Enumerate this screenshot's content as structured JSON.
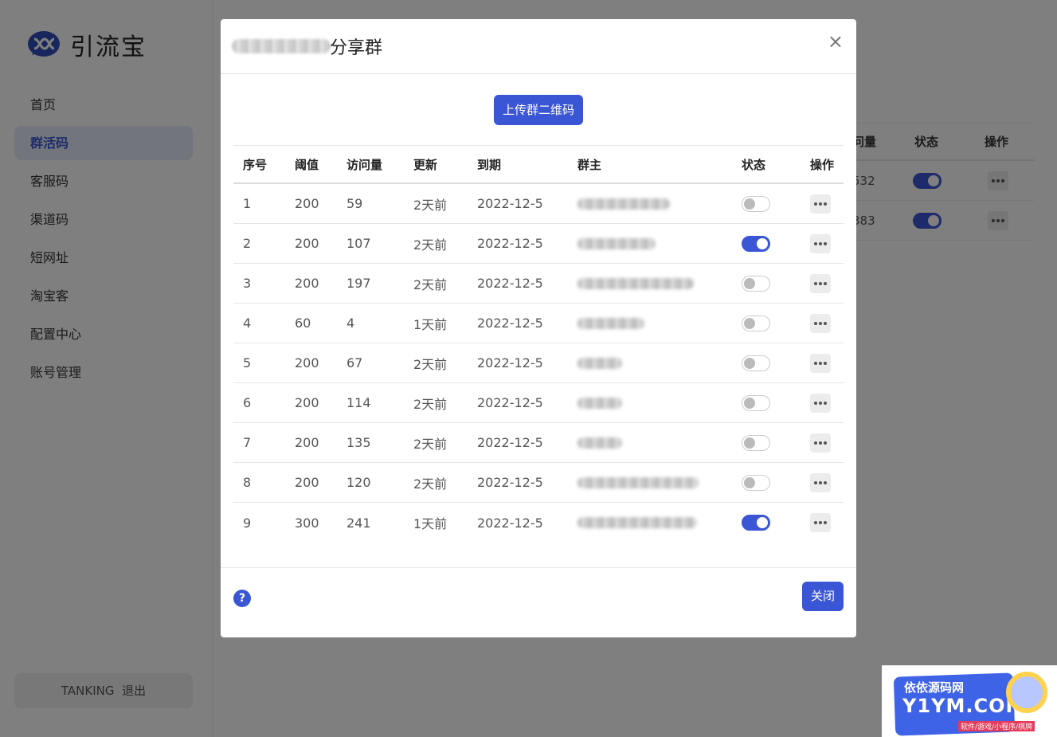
{
  "app": {
    "name": "引流宝",
    "nav": [
      "首页",
      "群活码",
      "客服码",
      "渠道码",
      "短网址",
      "淘宝客",
      "配置中心",
      "账号管理"
    ],
    "active_nav": "群活码",
    "user": {
      "name": "TANKING",
      "logout": "退出"
    }
  },
  "background_table": {
    "headers": {
      "visits": "问量",
      "status": "状态",
      "actions": "操作"
    },
    "rows": [
      {
        "visits": "532",
        "status": true
      },
      {
        "visits": "383",
        "status": true
      }
    ]
  },
  "modal": {
    "title_suffix": "分享群",
    "close_symbol": "×",
    "upload_button": "上传群二维码",
    "columns": {
      "index": "序号",
      "threshold": "阈值",
      "visits": "访问量",
      "updated": "更新",
      "expires": "到期",
      "owner": "群主",
      "status": "状态",
      "actions": "操作"
    },
    "rows": [
      {
        "index": "1",
        "threshold": "200",
        "visits": "59",
        "updated": "2天前",
        "expires": "2022-12-5",
        "status": false
      },
      {
        "index": "2",
        "threshold": "200",
        "visits": "107",
        "updated": "2天前",
        "expires": "2022-12-5",
        "status": true
      },
      {
        "index": "3",
        "threshold": "200",
        "visits": "197",
        "updated": "2天前",
        "expires": "2022-12-5",
        "status": false
      },
      {
        "index": "4",
        "threshold": "60",
        "visits": "4",
        "updated": "1天前",
        "expires": "2022-12-5",
        "status": false
      },
      {
        "index": "5",
        "threshold": "200",
        "visits": "67",
        "updated": "2天前",
        "expires": "2022-12-5",
        "status": false
      },
      {
        "index": "6",
        "threshold": "200",
        "visits": "114",
        "updated": "2天前",
        "expires": "2022-12-5",
        "status": false
      },
      {
        "index": "7",
        "threshold": "200",
        "visits": "135",
        "updated": "2天前",
        "expires": "2022-12-5",
        "status": false
      },
      {
        "index": "8",
        "threshold": "200",
        "visits": "120",
        "updated": "2天前",
        "expires": "2022-12-5",
        "status": false
      },
      {
        "index": "9",
        "threshold": "300",
        "visits": "241",
        "updated": "1天前",
        "expires": "2022-12-5",
        "status": true
      }
    ],
    "help_symbol": "?",
    "close_button": "关闭"
  },
  "watermark": {
    "line1": "依依源码网",
    "line2": "Y1YM.COM",
    "line3": "软件/游戏/小程序/棋牌"
  },
  "colors": {
    "primary": "#3a56d4",
    "backdrop": "rgba(0,0,0,0.5)"
  }
}
